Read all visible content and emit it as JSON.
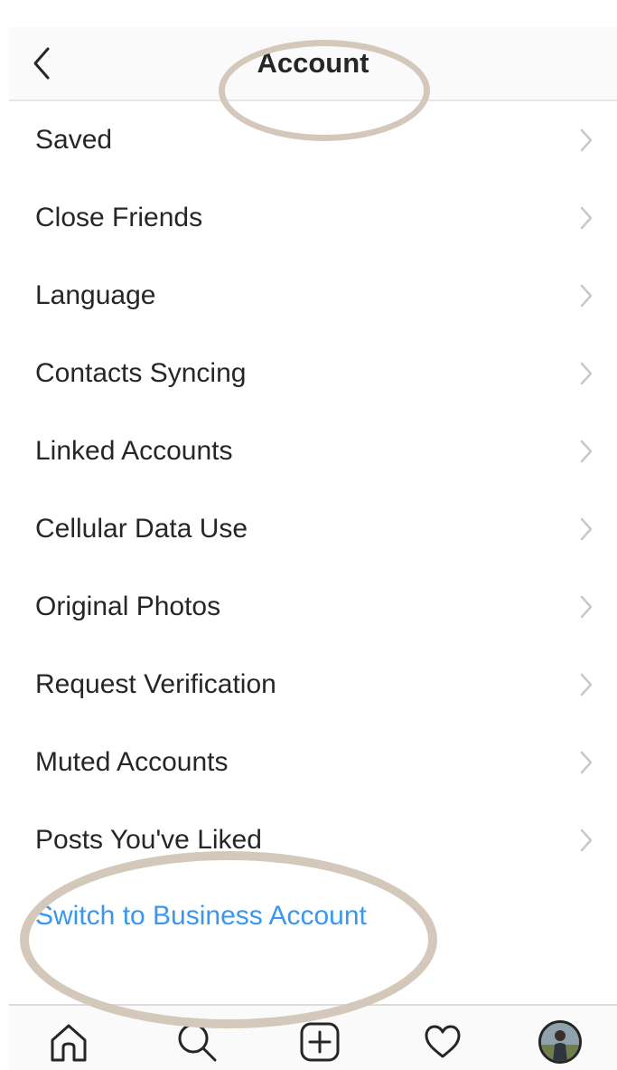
{
  "header": {
    "title": "Account",
    "back_icon": "chevron-left-icon"
  },
  "settings": {
    "items": [
      {
        "label": "Saved"
      },
      {
        "label": "Close Friends"
      },
      {
        "label": "Language"
      },
      {
        "label": "Contacts Syncing"
      },
      {
        "label": "Linked Accounts"
      },
      {
        "label": "Cellular Data Use"
      },
      {
        "label": "Original Photos"
      },
      {
        "label": "Request Verification"
      },
      {
        "label": "Muted Accounts"
      },
      {
        "label": "Posts You've Liked"
      }
    ],
    "chevron_icon": "chevron-right-icon",
    "business_link": "Switch to Business Account"
  },
  "tabbar": {
    "tabs": [
      {
        "icon": "home-icon"
      },
      {
        "icon": "search-icon"
      },
      {
        "icon": "new-post-icon"
      },
      {
        "icon": "heart-icon"
      },
      {
        "icon": "profile-avatar"
      }
    ]
  },
  "colors": {
    "text": "#262626",
    "link": "#3897f0",
    "chevron": "#c7c7cc",
    "highlight": "#d3c8b9",
    "divider": "#e6e6e6"
  }
}
